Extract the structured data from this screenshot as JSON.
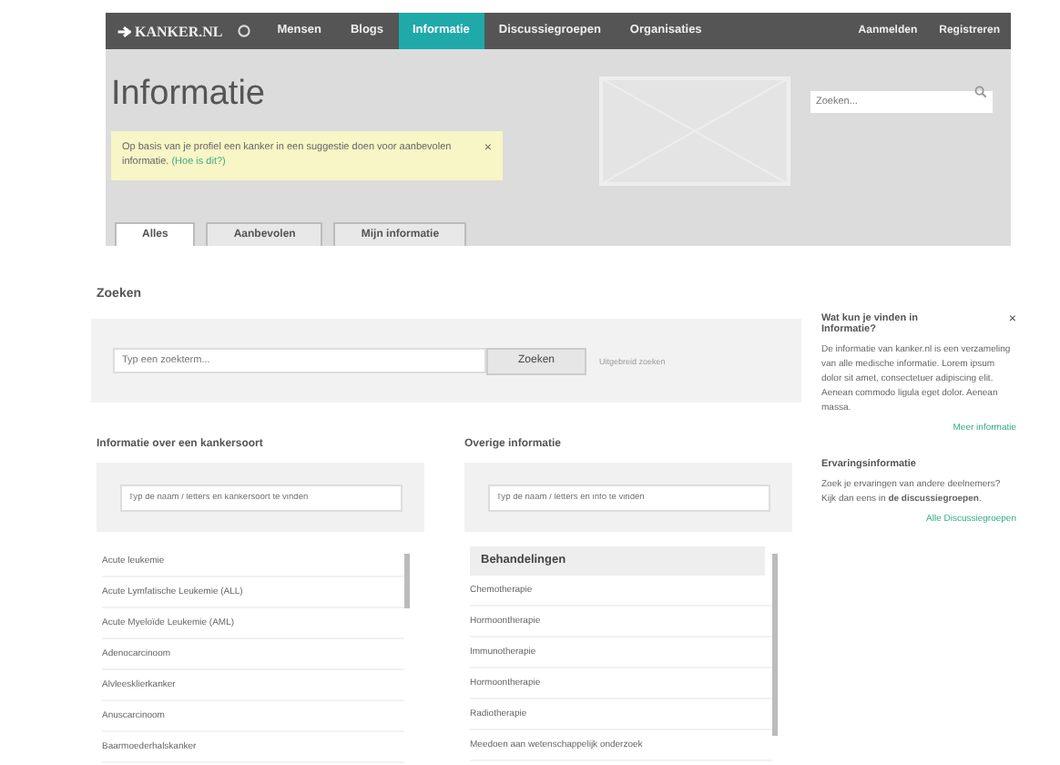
{
  "nav": {
    "logo": "KANKER.NL",
    "items": [
      {
        "label": "Mensen",
        "selected": false
      },
      {
        "label": "Blogs",
        "selected": false
      },
      {
        "label": "Informatie",
        "selected": true
      },
      {
        "label": "Discussiegroepen",
        "selected": false
      },
      {
        "label": "Organisaties",
        "selected": false
      }
    ],
    "account": [
      "Aanmelden",
      "Registreren"
    ]
  },
  "header": {
    "title": "Informatie",
    "search": {
      "placeholder": "Zoeken..."
    },
    "notice": {
      "text": "Op basis van je profiel een kanker in een suggestie doen voor aanbevolen informatie.",
      "link": "(Hoe is dit?)",
      "close": "×"
    }
  },
  "tabs": [
    {
      "label": "Alles",
      "selected": true
    },
    {
      "label": "Aanbevolen",
      "selected": false
    },
    {
      "label": "Mijn informatie",
      "selected": false
    }
  ],
  "search": {
    "heading": "Zoeken",
    "placeholder": "Typ een zoekterm...",
    "button": "Zoeken",
    "link": "Uitgebreid zoeken"
  },
  "columns": [
    {
      "heading": "Informatie over een kankersoort",
      "placeholder": "Typ de naam / letters en kankersoort te vinden",
      "items": [
        "Acute leukemie",
        "Acute Lymfatische Leukemie (ALL)",
        "Acute Myeloïde Leukemie (AML)",
        "Adenocarcinoom",
        "Alvleesklierkanker",
        "Anuscarcinoom",
        "Baarmoederhalskanker"
      ]
    },
    {
      "heading": "Overige informatie",
      "placeholder": "Typ de naam / letters en info te vinden",
      "group": "Behandelingen",
      "items": [
        "Chemotherapie",
        "Hormoontherapie",
        "Immunotherapie",
        "Hormoontherapie",
        "Radiotherapie",
        "Meedoen aan wetenschappelijk onderzoek"
      ]
    }
  ],
  "sidebar": [
    {
      "title": "Wat kun je vinden in Informatie?",
      "close": "×",
      "text": "De informatie van kanker.nl is een verzameling van alle medische informatie. Lorem ipsum dolor sit amet, consectetuer adipiscing elit. Aenean commodo ligula eget dolor. Aenean massa.",
      "link": "Meer informatie"
    },
    {
      "title": "Ervaringsinformatie",
      "text": "Zoek je ervaringen van andere deelnemers? Kijk dan eens in **de discussiegroepen**.",
      "link": "Alle Discussiegroepen"
    }
  ]
}
